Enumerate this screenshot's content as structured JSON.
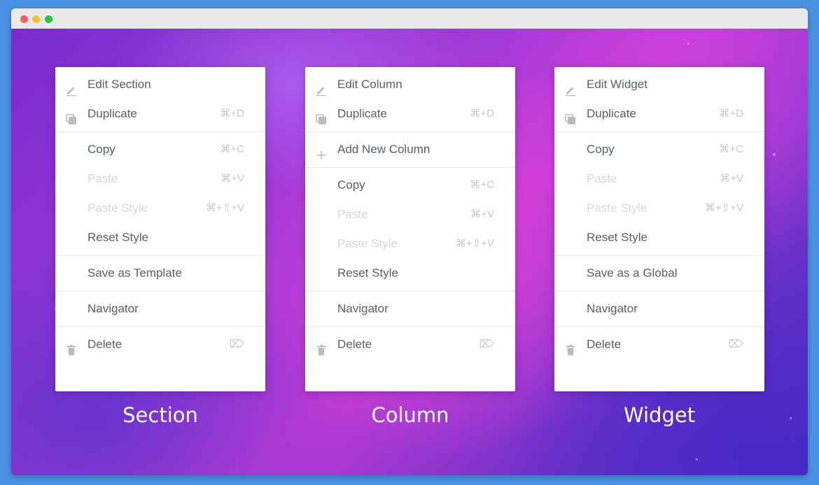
{
  "colors": {
    "text": "#556068",
    "disabled_text": "#d3d7da",
    "shortcut": "#c3c8cc",
    "icon": "#b7bcc1",
    "menu_bg": "#ffffff",
    "outer_bg": "#4a90e2"
  },
  "menus": [
    {
      "caption": "Section",
      "groups": [
        [
          {
            "icon": "pencil-icon",
            "label": "Edit Section",
            "shortcut": "",
            "disabled": false
          },
          {
            "icon": "duplicate-icon",
            "label": "Duplicate",
            "shortcut": "⌘+D",
            "disabled": false
          }
        ],
        [
          {
            "icon": "",
            "label": "Copy",
            "shortcut": "⌘+C",
            "disabled": false
          },
          {
            "icon": "",
            "label": "Paste",
            "shortcut": "⌘+V",
            "disabled": true
          },
          {
            "icon": "",
            "label": "Paste Style",
            "shortcut": "⌘+⇧+V",
            "disabled": true
          },
          {
            "icon": "",
            "label": "Reset Style",
            "shortcut": "",
            "disabled": false
          }
        ],
        [
          {
            "icon": "",
            "label": "Save as Template",
            "shortcut": "",
            "disabled": false
          }
        ],
        [
          {
            "icon": "",
            "label": "Navigator",
            "shortcut": "",
            "disabled": false
          }
        ],
        [
          {
            "icon": "trash-icon",
            "label": "Delete",
            "shortcut": "⌦",
            "disabled": false
          }
        ]
      ]
    },
    {
      "caption": "Column",
      "groups": [
        [
          {
            "icon": "pencil-icon",
            "label": "Edit Column",
            "shortcut": "",
            "disabled": false
          },
          {
            "icon": "duplicate-icon",
            "label": "Duplicate",
            "shortcut": "⌘+D",
            "disabled": false
          }
        ],
        [
          {
            "icon": "plus-icon",
            "label": "Add New Column",
            "shortcut": "",
            "disabled": false
          }
        ],
        [
          {
            "icon": "",
            "label": "Copy",
            "shortcut": "⌘+C",
            "disabled": false
          },
          {
            "icon": "",
            "label": "Paste",
            "shortcut": "⌘+V",
            "disabled": true
          },
          {
            "icon": "",
            "label": "Paste Style",
            "shortcut": "⌘+⇧+V",
            "disabled": true
          },
          {
            "icon": "",
            "label": "Reset Style",
            "shortcut": "",
            "disabled": false
          }
        ],
        [
          {
            "icon": "",
            "label": "Navigator",
            "shortcut": "",
            "disabled": false
          }
        ],
        [
          {
            "icon": "trash-icon",
            "label": "Delete",
            "shortcut": "⌦",
            "disabled": false
          }
        ]
      ]
    },
    {
      "caption": "Widget",
      "groups": [
        [
          {
            "icon": "pencil-icon",
            "label": "Edit Widget",
            "shortcut": "",
            "disabled": false
          },
          {
            "icon": "duplicate-icon",
            "label": "Duplicate",
            "shortcut": "⌘+D",
            "disabled": false
          }
        ],
        [
          {
            "icon": "",
            "label": "Copy",
            "shortcut": "⌘+C",
            "disabled": false
          },
          {
            "icon": "",
            "label": "Paste",
            "shortcut": "⌘+V",
            "disabled": true
          },
          {
            "icon": "",
            "label": "Paste Style",
            "shortcut": "⌘+⇧+V",
            "disabled": true
          },
          {
            "icon": "",
            "label": "Reset Style",
            "shortcut": "",
            "disabled": false
          }
        ],
        [
          {
            "icon": "",
            "label": "Save as a Global",
            "shortcut": "",
            "disabled": false
          }
        ],
        [
          {
            "icon": "",
            "label": "Navigator",
            "shortcut": "",
            "disabled": false
          }
        ],
        [
          {
            "icon": "trash-icon",
            "label": "Delete",
            "shortcut": "⌦",
            "disabled": false
          }
        ]
      ]
    }
  ]
}
